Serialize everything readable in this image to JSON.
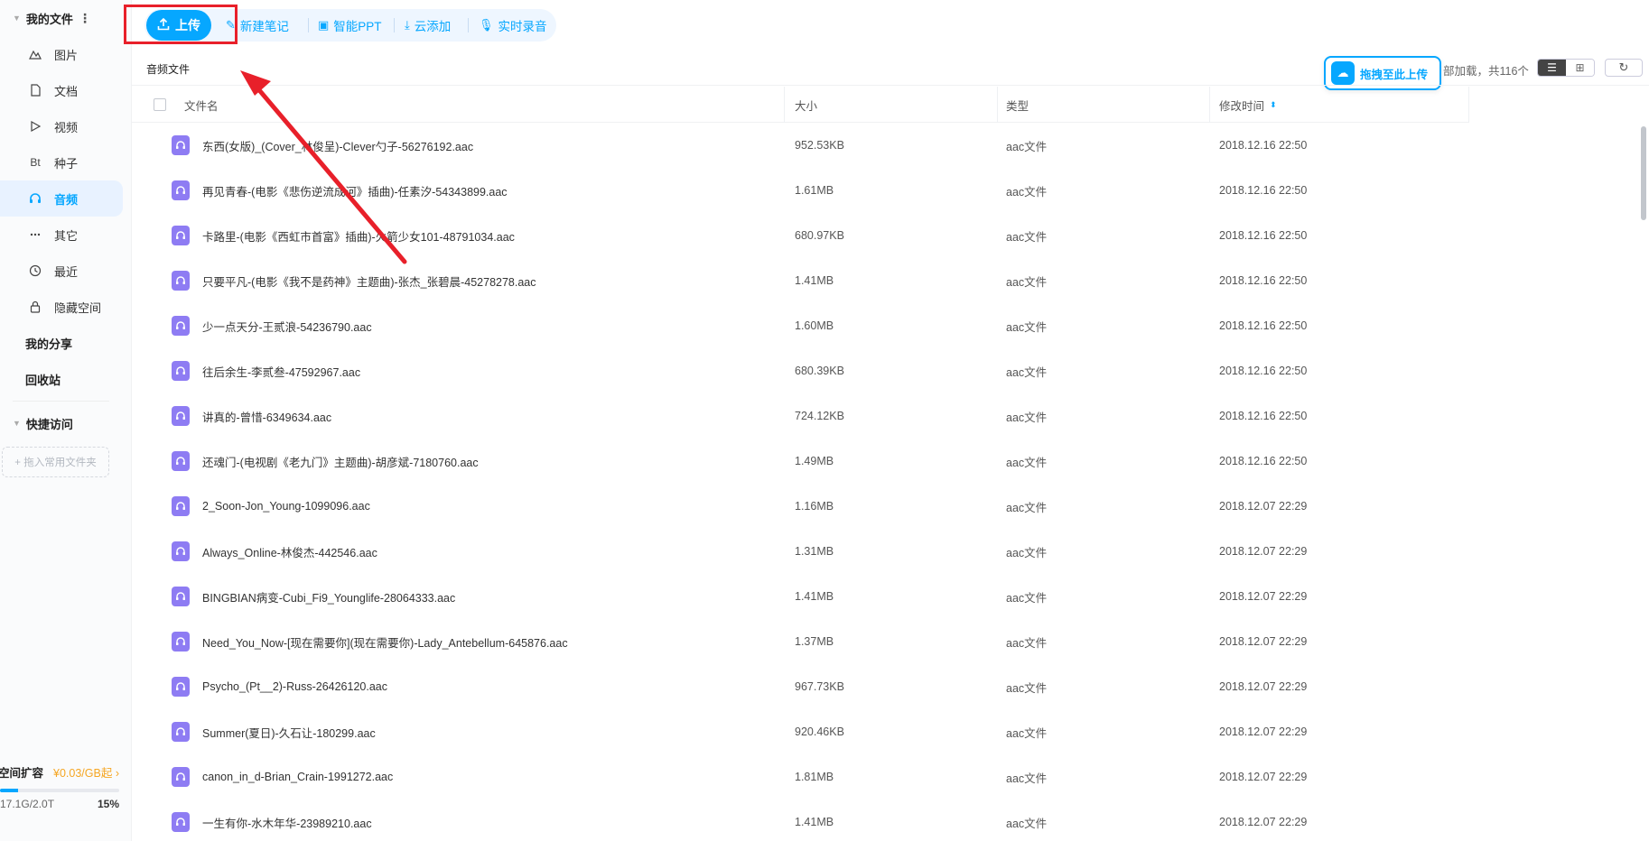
{
  "sidebar": {
    "my_files": "我的文件",
    "items": [
      {
        "label": "图片",
        "icon": "image-icon"
      },
      {
        "label": "文档",
        "icon": "document-icon"
      },
      {
        "label": "视频",
        "icon": "video-icon"
      },
      {
        "label": "种子",
        "icon": "bt-icon",
        "glyph": "Bt"
      },
      {
        "label": "音频",
        "icon": "headphones-icon",
        "active": true
      },
      {
        "label": "其它",
        "icon": "more-icon"
      },
      {
        "label": "最近",
        "icon": "clock-icon"
      },
      {
        "label": "隐藏空间",
        "icon": "lock-icon"
      }
    ],
    "my_share": "我的分享",
    "recycle_bin": "回收站",
    "quick_access": "快捷访问",
    "drop_hint": "+ 拖入常用文件夹",
    "quota": {
      "title": "空间扩容",
      "promo": "¥0.03/GB起",
      "used": "17.1G/2.0T",
      "percent_label": "15%",
      "percent": 0.15
    }
  },
  "toolbar": {
    "upload": "上传",
    "new_note": "新建笔记",
    "smart_ppt": "智能PPT",
    "cloud_add": "云添加",
    "live_record": "实时录音"
  },
  "content": {
    "breadcrumb": "音频文件",
    "drag_upload": "拖拽至此上传",
    "load_info": "部加载，共116个"
  },
  "table": {
    "headers": {
      "name": "文件名",
      "size": "大小",
      "type": "类型",
      "modified": "修改时间"
    },
    "rows": [
      {
        "name": "东西(女版)_(Cover_林俊呈)-Clever勺子-56276192.aac",
        "size": "952.53KB",
        "type": "aac文件",
        "modified": "2018.12.16 22:50"
      },
      {
        "name": "再见青春-(电影《悲伤逆流成河》插曲)-任素汐-54343899.aac",
        "size": "1.61MB",
        "type": "aac文件",
        "modified": "2018.12.16 22:50"
      },
      {
        "name": "卡路里-(电影《西虹市首富》插曲)-火箭少女101-48791034.aac",
        "size": "680.97KB",
        "type": "aac文件",
        "modified": "2018.12.16 22:50"
      },
      {
        "name": "只要平凡-(电影《我不是药神》主题曲)-张杰_张碧晨-45278278.aac",
        "size": "1.41MB",
        "type": "aac文件",
        "modified": "2018.12.16 22:50"
      },
      {
        "name": "少一点天分-王贰浪-54236790.aac",
        "size": "1.60MB",
        "type": "aac文件",
        "modified": "2018.12.16 22:50"
      },
      {
        "name": "往后余生-李贰叁-47592967.aac",
        "size": "680.39KB",
        "type": "aac文件",
        "modified": "2018.12.16 22:50"
      },
      {
        "name": "讲真的-曾惜-6349634.aac",
        "size": "724.12KB",
        "type": "aac文件",
        "modified": "2018.12.16 22:50"
      },
      {
        "name": "还魂门-(电视剧《老九门》主题曲)-胡彦斌-7180760.aac",
        "size": "1.49MB",
        "type": "aac文件",
        "modified": "2018.12.16 22:50"
      },
      {
        "name": "2_Soon-Jon_Young-1099096.aac",
        "size": "1.16MB",
        "type": "aac文件",
        "modified": "2018.12.07 22:29"
      },
      {
        "name": "Always_Online-林俊杰-442546.aac",
        "size": "1.31MB",
        "type": "aac文件",
        "modified": "2018.12.07 22:29"
      },
      {
        "name": "BINGBIAN病变-Cubi_Fi9_Younglife-28064333.aac",
        "size": "1.41MB",
        "type": "aac文件",
        "modified": "2018.12.07 22:29"
      },
      {
        "name": "Need_You_Now-[现在需要你](现在需要你)-Lady_Antebellum-645876.aac",
        "size": "1.37MB",
        "type": "aac文件",
        "modified": "2018.12.07 22:29"
      },
      {
        "name": "Psycho_(Pt__2)-Russ-26426120.aac",
        "size": "967.73KB",
        "type": "aac文件",
        "modified": "2018.12.07 22:29"
      },
      {
        "name": "Summer(夏日)-久石让-180299.aac",
        "size": "920.46KB",
        "type": "aac文件",
        "modified": "2018.12.07 22:29"
      },
      {
        "name": "canon_in_d-Brian_Crain-1991272.aac",
        "size": "1.81MB",
        "type": "aac文件",
        "modified": "2018.12.07 22:29"
      },
      {
        "name": "一生有你-水木年华-23989210.aac",
        "size": "1.41MB",
        "type": "aac文件",
        "modified": "2018.12.07 22:29"
      }
    ]
  },
  "colors": {
    "accent": "#06a7ff",
    "annotation_red": "#e8202a",
    "file_icon": "#8e7cf3"
  }
}
